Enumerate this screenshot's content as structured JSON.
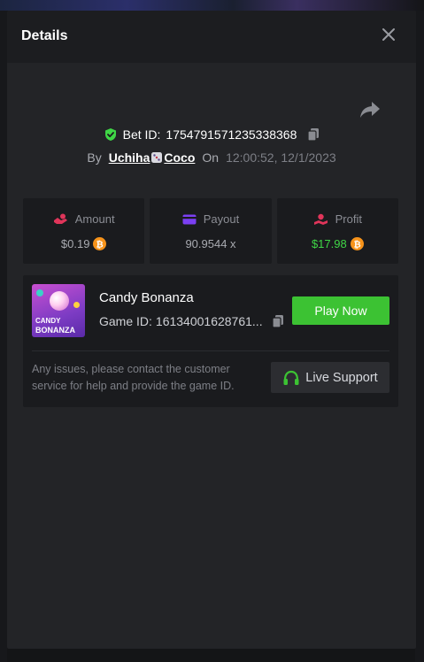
{
  "modal": {
    "title": "Details",
    "bet_id_label": "Bet ID:",
    "bet_id": "1754791571235338368",
    "by_label": "By",
    "user_name_part1": "Uchiha",
    "user_name_part2": "Coco",
    "on_label": "On",
    "timestamp": "12:00:52, 12/1/2023"
  },
  "stats": [
    {
      "label": "Amount",
      "value": "$0.19",
      "icon": "bet-hand-icon",
      "currency_icon": "bitcoin-icon"
    },
    {
      "label": "Payout",
      "value": "90.9544 x",
      "icon": "card-icon"
    },
    {
      "label": "Profit",
      "value": "$17.98",
      "icon": "profit-icon",
      "currency_icon": "bitcoin-icon"
    }
  ],
  "game": {
    "name": "Candy Bonanza",
    "thumb_line1": "CANDY",
    "thumb_line2": "BONANZA",
    "id_label": "Game ID:",
    "id_value": "16134001628761...",
    "play_label": "Play Now",
    "issue_text": "Any issues, please contact the customer service for help and provide the game ID.",
    "support_label": "Live Support"
  },
  "colors": {
    "accent_green": "#3cc233",
    "profit_green": "#3fd646",
    "bitcoin_orange": "#f7931a",
    "amount_icon": "#e0355a",
    "payout_icon": "#7b3ff2",
    "profit_icon": "#e0355a"
  }
}
